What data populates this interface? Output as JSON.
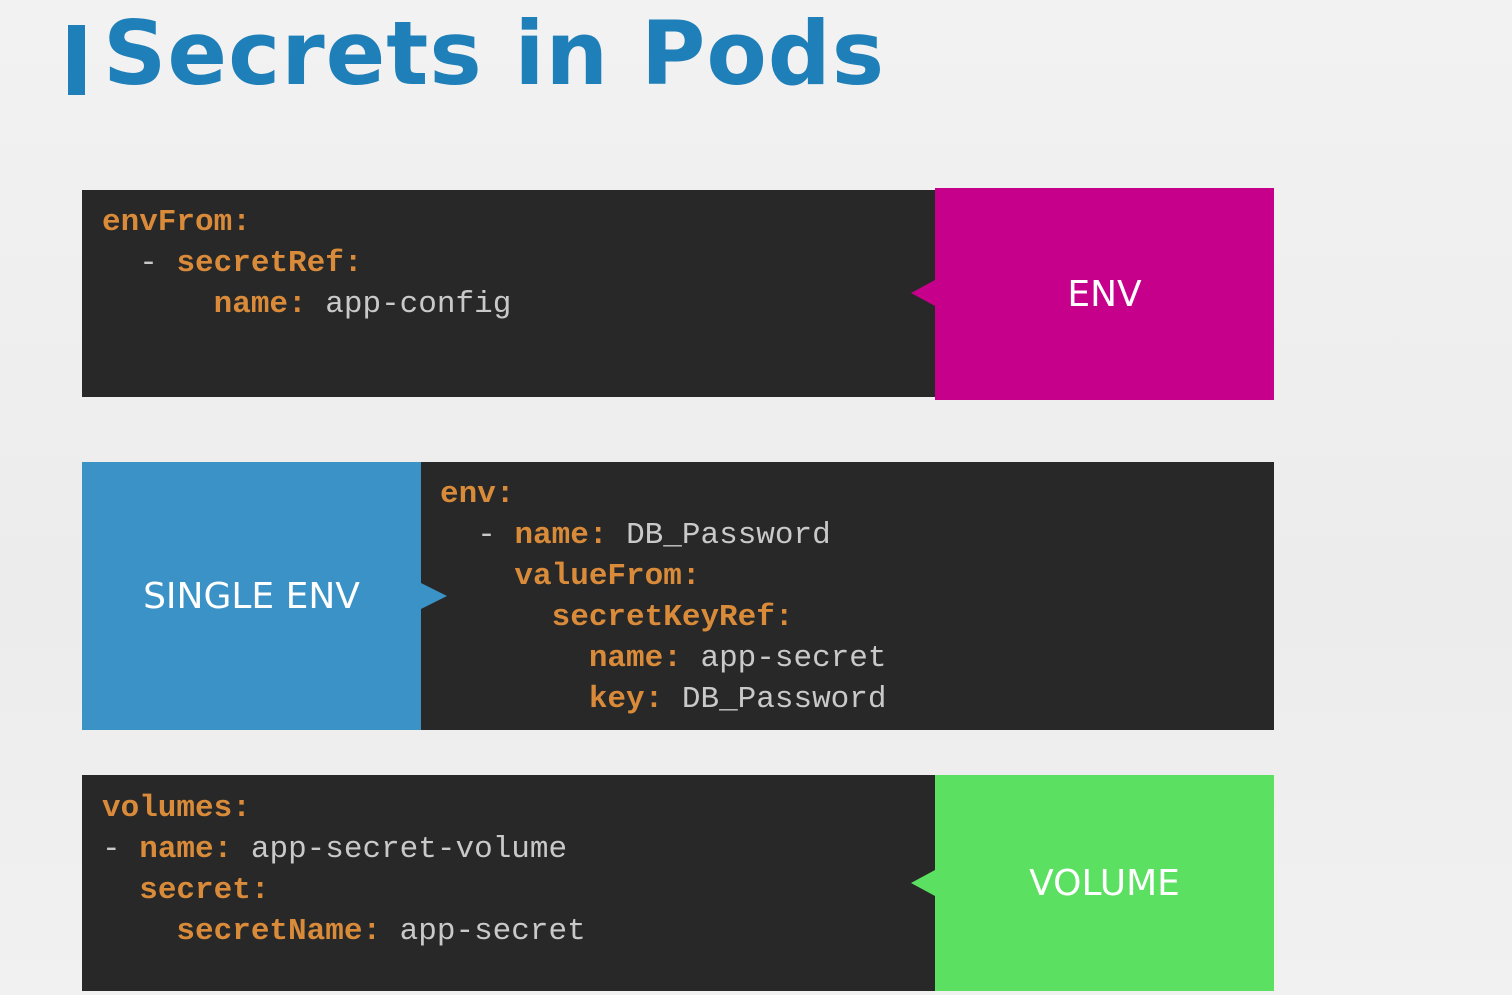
{
  "slide": {
    "title": "Secrets in Pods"
  },
  "colors": {
    "title": "#1f7fb8",
    "panel_bg": "#282828",
    "yaml_key": "#d98b3a",
    "yaml_value": "#c9c9c9",
    "env_tag": "#c6008a",
    "single_env_tag": "#3a92c6",
    "volume_tag": "#5ce061"
  },
  "panels": {
    "env": {
      "tag": "ENV",
      "lines": [
        {
          "indent": "",
          "dash": "",
          "key": "envFrom",
          "value": ""
        },
        {
          "indent": "  ",
          "dash": "- ",
          "key": "secretRef",
          "value": ""
        },
        {
          "indent": "      ",
          "dash": "",
          "key": "name",
          "value": "app-config"
        }
      ]
    },
    "single_env": {
      "tag": "SINGLE ENV",
      "lines": [
        {
          "indent": "",
          "dash": "",
          "key": "env",
          "value": ""
        },
        {
          "indent": "  ",
          "dash": "- ",
          "key": "name",
          "value": "DB_Password"
        },
        {
          "indent": "    ",
          "dash": "",
          "key": "valueFrom",
          "value": ""
        },
        {
          "indent": "      ",
          "dash": "",
          "key": "secretKeyRef",
          "value": ""
        },
        {
          "indent": "        ",
          "dash": "",
          "key": "name",
          "value": "app-secret"
        },
        {
          "indent": "        ",
          "dash": "",
          "key": "key",
          "value": "DB_Password"
        }
      ]
    },
    "volume": {
      "tag": "VOLUME",
      "lines": [
        {
          "indent": "",
          "dash": "",
          "key": "volumes",
          "value": ""
        },
        {
          "indent": "",
          "dash": "- ",
          "key": "name",
          "value": "app-secret-volume"
        },
        {
          "indent": "  ",
          "dash": "",
          "key": "secret",
          "value": ""
        },
        {
          "indent": "    ",
          "dash": "",
          "key": "secretName",
          "value": "app-secret"
        }
      ]
    }
  }
}
